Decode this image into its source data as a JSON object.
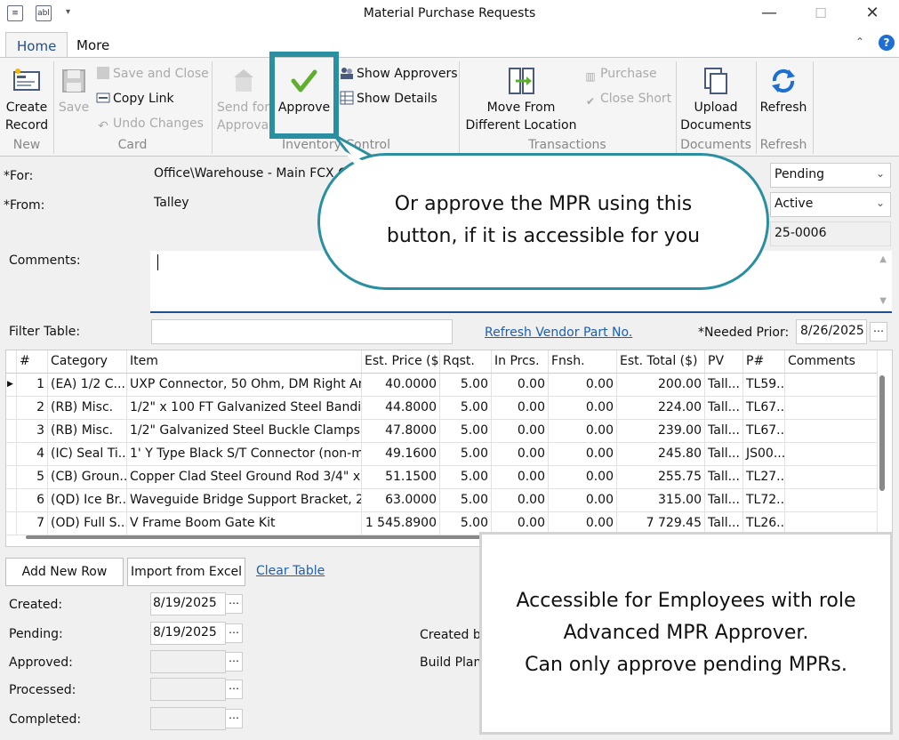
{
  "window": {
    "title": "Material Purchase Requests",
    "minimize": "—",
    "maximize": "☐",
    "close": "✕"
  },
  "tabs": [
    {
      "label": "Home"
    },
    {
      "label": "More"
    }
  ],
  "ribbon": {
    "create_record": "Create Record",
    "save": "Save",
    "save_and_close": "Save and Close",
    "copy_link": "Copy Link",
    "undo_changes": "Undo Changes",
    "send_for": "Send for",
    "approva": "Approva",
    "approve": "Approve",
    "show_approvers": "Show Approvers",
    "show_details": "Show Details",
    "move_from_line1": "Move From",
    "move_from_line2": "Different Location",
    "purchase": "Purchase",
    "close_short": "Close Short",
    "upload_line1": "Upload",
    "upload_line2": "Documents",
    "refresh": "Refresh",
    "groups": {
      "new": "New",
      "card": "Card",
      "inventory_control": "Inventory Control",
      "transactions": "Transactions",
      "documents": "Documents",
      "refresh": "Refresh"
    }
  },
  "form": {
    "for_label": "*For:",
    "for_value": "Office\\Warehouse - Main FCX C",
    "from_label": "*From:",
    "from_value": "Talley",
    "status_value": "Pending",
    "state_value": "Active",
    "number_value": "25-0006",
    "comments_label": "Comments:",
    "filter_label": "Filter Table:",
    "refresh_vendor_link": "Refresh Vendor Part No.",
    "needed_prior_label": "*Needed Prior:",
    "needed_prior_value": "8/26/2025"
  },
  "table": {
    "columns": [
      "#",
      "Category",
      "Item",
      "Est. Price ($)",
      "Rqst.",
      "In Prcs.",
      "Fnsh.",
      "Est. Total ($)",
      "PV",
      "P#",
      "Comments"
    ],
    "rows": [
      [
        "1",
        "(EA) 1/2 C...",
        "UXP Connector, 50 Ohm, DM Right An...",
        "40.0000",
        "5.00",
        "0.00",
        "0.00",
        "200.00",
        "Tall...",
        "TL59...",
        ""
      ],
      [
        "2",
        "(RB) Misc.",
        "1/2\" x 100 FT Galvanized Steel Banding",
        "44.8000",
        "5.00",
        "0.00",
        "0.00",
        "224.00",
        "Tall...",
        "TL67...",
        ""
      ],
      [
        "3",
        "(RB) Misc.",
        "1/2\" Galvanized Steel Buckle Clamps ...",
        "47.8000",
        "5.00",
        "0.00",
        "0.00",
        "239.00",
        "Tall...",
        "TL67...",
        ""
      ],
      [
        "4",
        "(IC) Seal Ti...",
        "1' Y Type Black S/T Connector (non-m...",
        "49.1600",
        "5.00",
        "0.00",
        "0.00",
        "245.80",
        "Tall...",
        "JS00...",
        ""
      ],
      [
        "5",
        "(CB) Groun...",
        "Copper Clad Steel Ground Rod 3/4\" x...",
        "51.1500",
        "5.00",
        "0.00",
        "0.00",
        "255.75",
        "Tall...",
        "TL27...",
        ""
      ],
      [
        "6",
        "(QD) Ice Br...",
        "Waveguide Bridge Support Bracket, 2...",
        "63.0000",
        "5.00",
        "0.00",
        "0.00",
        "315.00",
        "Tall...",
        "TL72...",
        ""
      ],
      [
        "7",
        "(OD) Full S...",
        "V Frame Boom Gate Kit",
        "1 545.8900",
        "5.00",
        "0.00",
        "0.00",
        "7 729.45",
        "Tall...",
        "TL26...",
        ""
      ]
    ]
  },
  "actions": {
    "add_new_row": "Add New Row",
    "import_from_excel": "Import from Excel",
    "clear_table": "Clear Table"
  },
  "dates": {
    "created_label": "Created:",
    "created_value": "8/19/2025",
    "pending_label": "Pending:",
    "pending_value": "8/19/2025",
    "approved_label": "Approved:",
    "processed_label": "Processed:",
    "completed_label": "Completed:",
    "created_by_label": "Created by",
    "build_plan_label": "Build Plan"
  },
  "callout": {
    "line1": "Or approve the MPR using this",
    "line2": "button, if it is accessible for you"
  },
  "info": {
    "line1": "Accessible for Employees with role",
    "line2": "Advanced MPR Approver.",
    "line3": "Can only approve pending MPRs."
  },
  "colors": {
    "accent": "#2a8fa0",
    "link": "#1a5fb4",
    "approve_check": "#5fae2e",
    "help": "#1e6fd1"
  }
}
